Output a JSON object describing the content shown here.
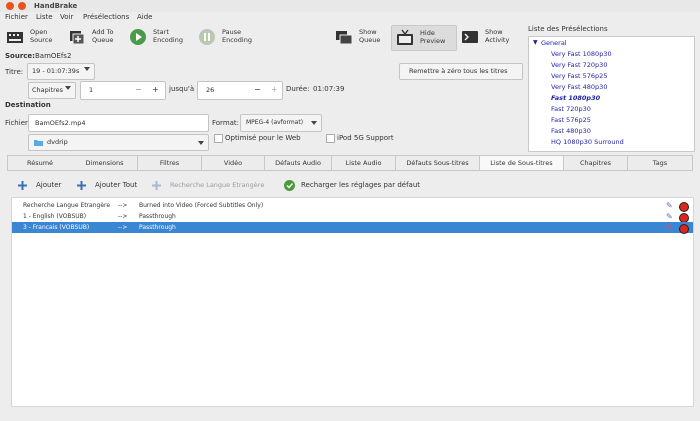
{
  "window": {
    "title": "HandBrake"
  },
  "menu": [
    "Fichier",
    "Liste",
    "Voir",
    "Présélections",
    "Aide"
  ],
  "toolbar": {
    "open_source": [
      "Open",
      "Source"
    ],
    "add_queue": [
      "Add To",
      "Queue"
    ],
    "start": [
      "Start",
      "Encoding"
    ],
    "pause": [
      "Pause",
      "Encoding"
    ],
    "show_queue": [
      "Show",
      "Queue"
    ],
    "hide_preview": [
      "Hide",
      "Preview"
    ],
    "show_activity": [
      "Show",
      "Activity"
    ]
  },
  "source": {
    "label": "Source:",
    "value": "BamOEfs2"
  },
  "title": {
    "label": "Titre:",
    "value": "19 - 01:07:39s"
  },
  "reset_button": "Remettre à zéro tous les titres",
  "range": {
    "mode": "Chapitres",
    "from": "1",
    "to_label": "jusqu'à",
    "to": "26",
    "duration_label": "Durée:",
    "duration": "01:07:39"
  },
  "destination": {
    "heading": "Destination",
    "file_label": "Fichier:",
    "file_value": "BamOEfs2.mp4",
    "folder": "dvdrip",
    "format_label": "Format:",
    "format_value": "MPEG-4 (avformat)",
    "web_optimized": "Optimisé pour le Web",
    "ipod": "iPod 5G Support"
  },
  "presets": {
    "heading": "Liste des Présélections",
    "group": "General",
    "items": [
      "Very Fast 1080p30",
      "Very Fast 720p30",
      "Very Fast 576p25",
      "Very Fast 480p30",
      "Fast 1080p30",
      "Fast 720p30",
      "Fast 576p25",
      "Fast 480p30",
      "HQ 1080p30 Surround"
    ],
    "selected": "Fast 1080p30"
  },
  "tabs": [
    "Résumé",
    "Dimensions",
    "Filtres",
    "Vidéo",
    "Défauts Audio",
    "Liste Audio",
    "Défauts Sous-titres",
    "Liste de Sous-titres",
    "Chapitres",
    "Tags"
  ],
  "active_tab": "Liste de Sous-titres",
  "subtitle_toolbar": {
    "add": "Ajouter",
    "add_all": "Ajouter Tout",
    "foreign_search": "Recherche Langue Etrangère",
    "reload": "Recharger les réglages par défaut"
  },
  "subtitle_rows": [
    {
      "source": "Recherche Langue Etrangère",
      "arrow": "-->",
      "dest": "Burned into Video (Forced Subtitles Only)"
    },
    {
      "source": "1 - English (VOBSUB)",
      "arrow": "-->",
      "dest": "Passthrough"
    },
    {
      "source": "3 - Francais (VOBSUB)",
      "arrow": "-->",
      "dest": "Passthrough"
    }
  ],
  "colors": {
    "selection": "#3a86d2",
    "preset_text": "#1f1fa8",
    "close_dot": "#e9541e"
  }
}
